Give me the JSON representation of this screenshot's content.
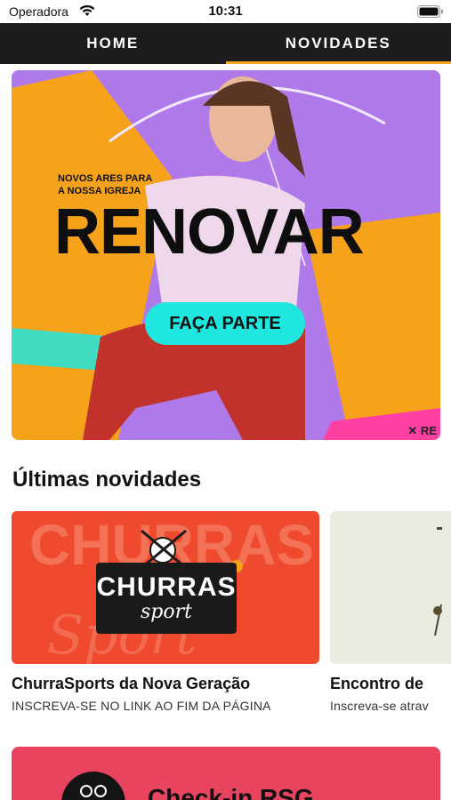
{
  "status_bar": {
    "carrier": "Operadora",
    "time": "10:31",
    "icons": [
      "wifi-icon",
      "battery-icon"
    ]
  },
  "tabs": [
    {
      "label": "HOME",
      "active": false
    },
    {
      "label": "NOVIDADES",
      "active": true
    }
  ],
  "colors": {
    "tab_bar": "#1c1c1e",
    "tab_indicator": "#f5a623",
    "hero_purple": "#b079ea",
    "hero_orange": "#f7a21b",
    "hero_cta": "#1fe6df",
    "churras_red": "#ef4a2e",
    "bottom_banner": "#e8435f"
  },
  "hero": {
    "kicker_line1": "NOVOS ARES PARA",
    "kicker_line2": "A NOSSA IGREJA",
    "title": "RENOVAR",
    "cta_label": "FAÇA PARTE",
    "watermark": "✕ RE"
  },
  "section": {
    "title": "Últimas novidades"
  },
  "cards": [
    {
      "image_text_main": "CHURRAS",
      "image_text_sub": "sport",
      "title": "ChurraSports da Nova Geração",
      "subtitle": "INSCREVA-SE NO LINK AO FIM DA PÁGINA"
    },
    {
      "title": "Encontro de",
      "subtitle": "Inscreva-se atrav"
    }
  ],
  "bottom_banner": {
    "text": "Check-in RSG"
  }
}
